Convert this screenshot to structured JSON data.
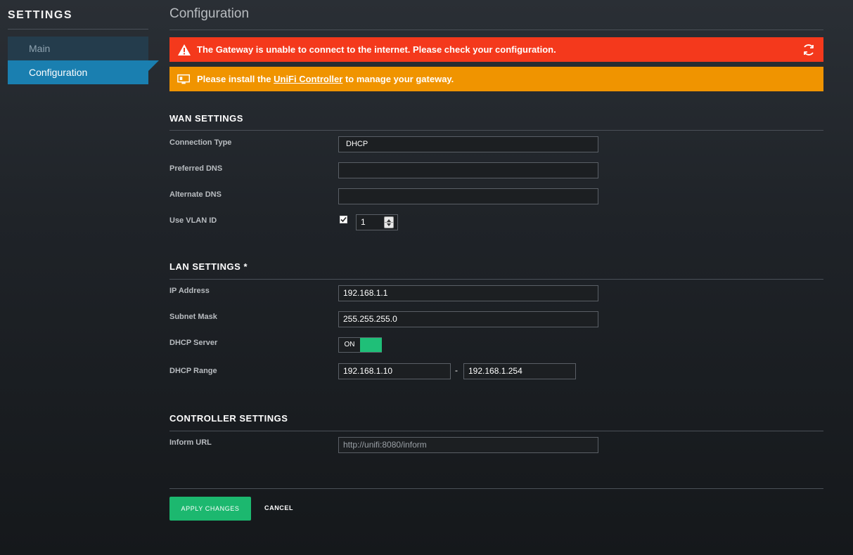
{
  "sidebar": {
    "title": "SETTINGS",
    "items": [
      {
        "label": "Main"
      },
      {
        "label": "Configuration"
      }
    ]
  },
  "page": {
    "title": "Configuration"
  },
  "alerts": {
    "error": {
      "text": "The Gateway is unable to connect to the internet. Please check your configuration.",
      "icon": "warning-triangle-icon",
      "action_icon": "refresh-icon"
    },
    "warning": {
      "text_before": "Please install the ",
      "link_text": "UniFi Controller",
      "text_after": " to manage your gateway.",
      "icon": "monitor-icon"
    }
  },
  "wan": {
    "title": "WAN SETTINGS",
    "connection_type_label": "Connection Type",
    "connection_type_value": "DHCP",
    "preferred_dns_label": "Preferred DNS",
    "preferred_dns_value": "",
    "alternate_dns_label": "Alternate DNS",
    "alternate_dns_value": "",
    "vlan_label": "Use VLAN ID",
    "vlan_checked": true,
    "vlan_value": "1"
  },
  "lan": {
    "title": "LAN SETTINGS *",
    "ip_label": "IP Address",
    "ip_value": "192.168.1.1",
    "subnet_label": "Subnet Mask",
    "subnet_value": "255.255.255.0",
    "dhcp_server_label": "DHCP Server",
    "dhcp_server_state": "ON",
    "dhcp_range_label": "DHCP Range",
    "dhcp_range_start": "192.168.1.10",
    "dhcp_range_sep": "-",
    "dhcp_range_end": "192.168.1.254"
  },
  "controller": {
    "title": "CONTROLLER SETTINGS",
    "inform_label": "Inform URL",
    "inform_placeholder": "http://unifi:8080/inform"
  },
  "actions": {
    "apply_label": "APPLY CHANGES",
    "cancel_label": "CANCEL"
  },
  "colors": {
    "accent": "#1a7fb0",
    "error": "#f4391c",
    "warning": "#f09400",
    "success": "#1cb86f"
  }
}
